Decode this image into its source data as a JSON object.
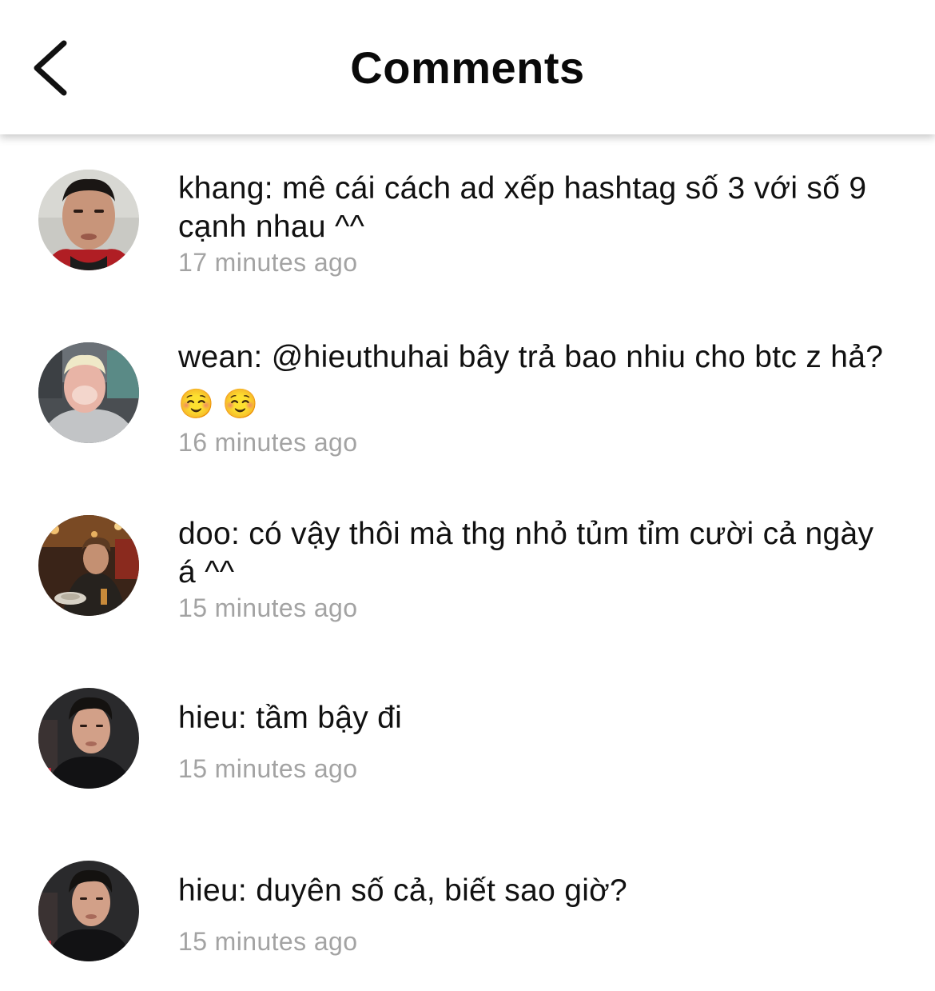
{
  "header": {
    "title": "Comments",
    "back_icon": "chevron-left-icon"
  },
  "colors": {
    "text": "#111111",
    "timestamp": "#a3a3a3",
    "background": "#ffffff"
  },
  "comments": [
    {
      "text": "khang: mê cái cách ad xếp hashtag số 3 với số 9 cạnh nhau ^^",
      "time": "17 minutes ago"
    },
    {
      "text": "wean: @hieuthuhai bây trả bao nhiu cho btc z hả?",
      "emoji": "☺️ ☺️",
      "time": "16 minutes ago"
    },
    {
      "text": "doo: có vậy thôi mà thg nhỏ tủm tỉm cười cả ngày á ^^",
      "time": "15 minutes ago"
    },
    {
      "text": "hieu: tầm bậy đi",
      "time": "15 minutes ago"
    },
    {
      "text": "hieu: duyên số cả, biết sao giờ?",
      "time": "15 minutes ago"
    }
  ]
}
